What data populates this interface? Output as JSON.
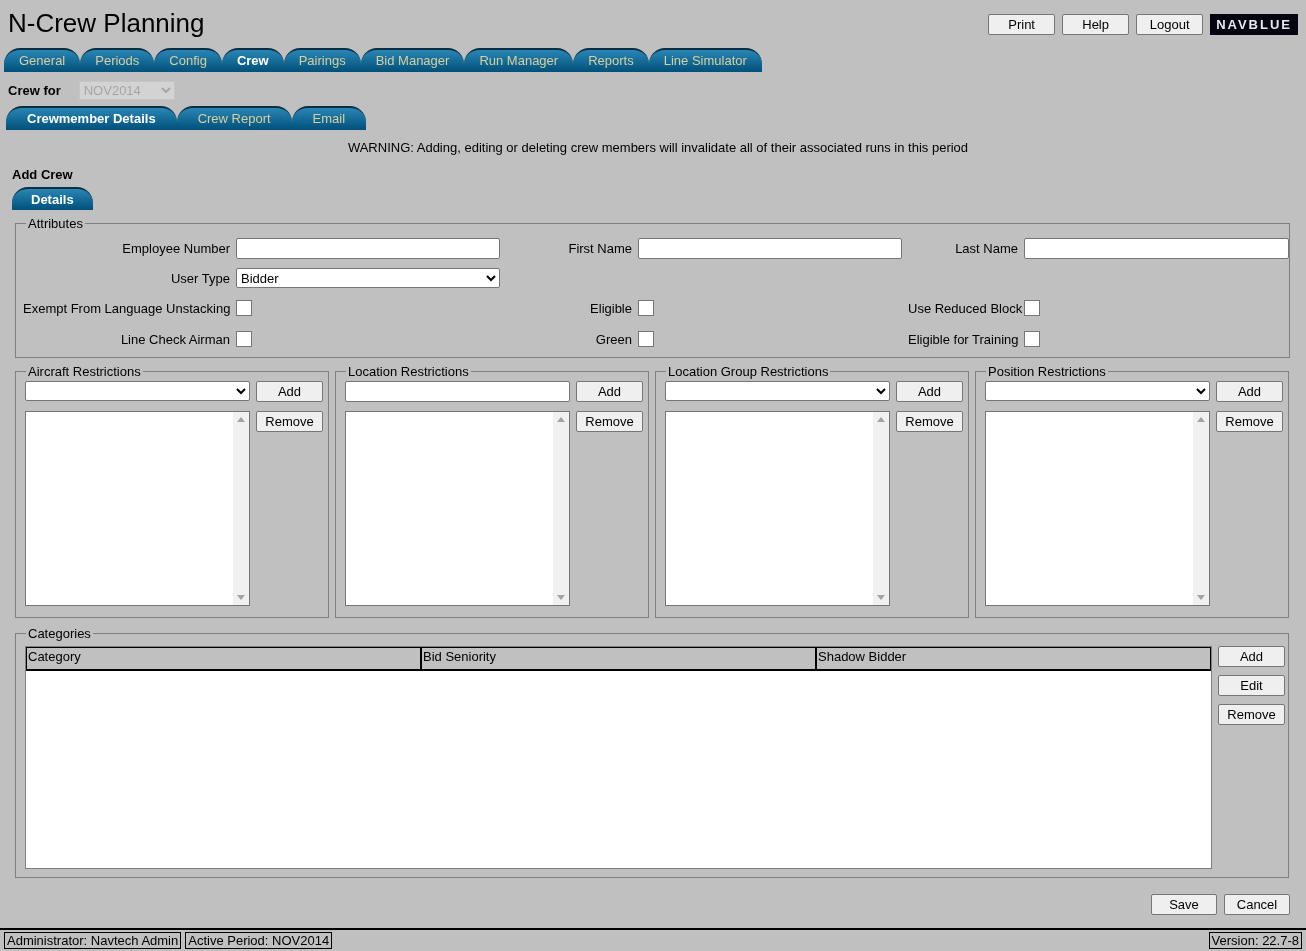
{
  "app_title": "N-Crew Planning",
  "header_buttons": [
    "Print",
    "Help",
    "Logout"
  ],
  "logo": "NAVBLUE",
  "main_tabs": [
    {
      "label": "General",
      "selected": false
    },
    {
      "label": "Periods",
      "selected": false
    },
    {
      "label": "Config",
      "selected": false
    },
    {
      "label": "Crew",
      "selected": true
    },
    {
      "label": "Pairings",
      "selected": false
    },
    {
      "label": "Bid Manager",
      "selected": false
    },
    {
      "label": "Run Manager",
      "selected": false
    },
    {
      "label": "Reports",
      "selected": false
    },
    {
      "label": "Line Simulator",
      "selected": false
    }
  ],
  "period_selector": {
    "label": "Crew for",
    "value": "NOV2014",
    "disabled": true
  },
  "sub_tabs": [
    {
      "label": "Crewmember Details",
      "selected": true
    },
    {
      "label": "Crew Report",
      "selected": false
    },
    {
      "label": "Email",
      "selected": false
    }
  ],
  "warning": "WARNING: Adding, editing or deleting crew members will invalidate all of their associated runs in this period",
  "section_title": "Add Crew",
  "detail_tabs": [
    {
      "label": "Details",
      "selected": true
    }
  ],
  "attributes": {
    "legend": "Attributes",
    "text_fields": [
      {
        "label": "Employee Number"
      },
      {
        "label": "First Name"
      },
      {
        "label": "Last Name"
      }
    ],
    "user_type": {
      "label": "User Type",
      "value": "Bidder"
    },
    "checkboxes": [
      {
        "label": "Exempt From Language Unstacking",
        "checked": false
      },
      {
        "label": "Eligible",
        "checked": false
      },
      {
        "label": "Use Reduced Block",
        "checked": false
      },
      {
        "label": "Line Check Airman",
        "checked": false
      },
      {
        "label": "Green",
        "checked": false
      },
      {
        "label": "Eligible for Training",
        "checked": false
      }
    ]
  },
  "restrictions": [
    {
      "legend": "Aircraft Restrictions",
      "kind": "select",
      "buttons": [
        "Add",
        "Remove"
      ]
    },
    {
      "legend": "Location Restrictions",
      "kind": "text",
      "buttons": [
        "Add",
        "Remove"
      ]
    },
    {
      "legend": "Location Group Restrictions",
      "kind": "select",
      "buttons": [
        "Add",
        "Remove"
      ]
    },
    {
      "legend": "Position Restrictions",
      "kind": "select",
      "buttons": [
        "Add",
        "Remove"
      ]
    }
  ],
  "categories": {
    "legend": "Categories",
    "columns": [
      "Category",
      "Bid Seniority",
      "Shadow Bidder"
    ],
    "buttons": [
      "Add",
      "Edit",
      "Remove"
    ]
  },
  "form_buttons": [
    "Save",
    "Cancel"
  ],
  "status_bar": {
    "left": [
      "Administrator: Navtech Admin",
      "Active Period: NOV2014"
    ],
    "right": "Version: 22.7-8"
  }
}
